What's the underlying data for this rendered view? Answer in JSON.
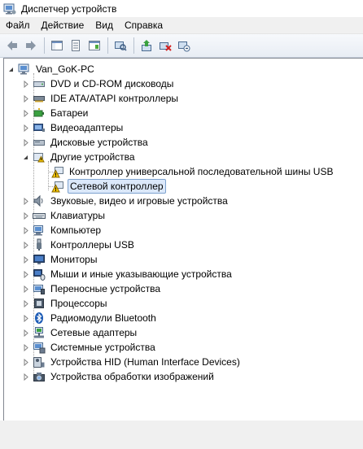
{
  "window": {
    "title": "Диспетчер устройств",
    "icon": "device-manager-icon"
  },
  "menu": [
    "Файл",
    "Действие",
    "Вид",
    "Справка"
  ],
  "toolbar": [
    "back-arrow-icon",
    "forward-arrow-icon",
    "show-hide-console-tree-icon",
    "properties-icon",
    "help-icon",
    "scan-hardware-icon",
    "update-driver-icon",
    "uninstall-icon",
    "disable-icon"
  ],
  "tree": {
    "root": "Van_GoK-PC",
    "categories": [
      {
        "label": "DVD и CD-ROM дисководы",
        "icon": "dvd-drive-icon"
      },
      {
        "label": "IDE ATA/ATAPI контроллеры",
        "icon": "ide-controller-icon"
      },
      {
        "label": "Батареи",
        "icon": "battery-icon"
      },
      {
        "label": "Видеоадаптеры",
        "icon": "display-adapter-icon"
      },
      {
        "label": "Дисковые устройства",
        "icon": "disk-drive-icon"
      },
      {
        "label": "Другие устройства",
        "icon": "unknown-device-icon",
        "expanded": true,
        "children": [
          {
            "label": "Контроллер универсальной последовательной шины USB",
            "icon": "warning-device-icon"
          },
          {
            "label": "Сетевой контроллер",
            "icon": "warning-device-icon",
            "selected": true
          }
        ]
      },
      {
        "label": "Звуковые, видео и игровые устройства",
        "icon": "speaker-icon"
      },
      {
        "label": "Клавиатуры",
        "icon": "keyboard-icon"
      },
      {
        "label": "Компьютер",
        "icon": "computer-icon"
      },
      {
        "label": "Контроллеры USB",
        "icon": "usb-icon"
      },
      {
        "label": "Мониторы",
        "icon": "monitor-icon"
      },
      {
        "label": "Мыши и иные указывающие устройства",
        "icon": "mouse-icon"
      },
      {
        "label": "Переносные устройства",
        "icon": "portable-device-icon"
      },
      {
        "label": "Процессоры",
        "icon": "processor-icon"
      },
      {
        "label": "Радиомодули Bluetooth",
        "icon": "bluetooth-icon"
      },
      {
        "label": "Сетевые адаптеры",
        "icon": "network-adapter-icon"
      },
      {
        "label": "Системные устройства",
        "icon": "system-device-icon"
      },
      {
        "label": "Устройства HID (Human Interface Devices)",
        "icon": "hid-icon"
      },
      {
        "label": "Устройства обработки изображений",
        "icon": "imaging-device-icon"
      }
    ]
  },
  "colors": {
    "selection": "#dbe8fa",
    "selection_border": "#7da2ce",
    "warning": "#f5c400"
  }
}
